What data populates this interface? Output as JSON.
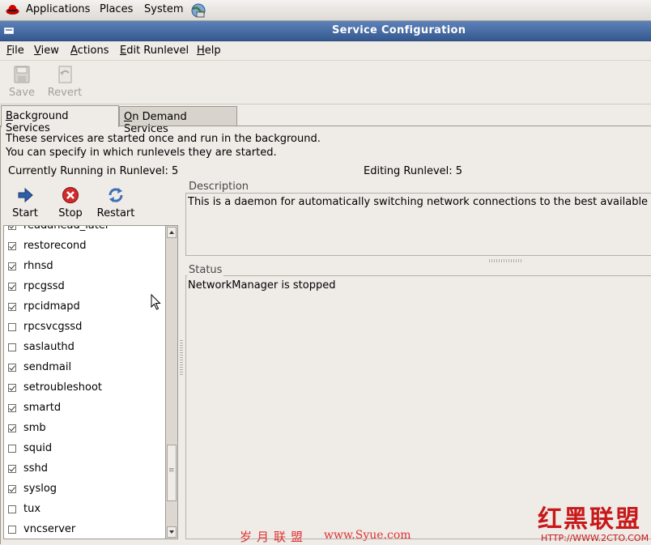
{
  "panel": {
    "applications": "Applications",
    "places": "Places",
    "system": "System"
  },
  "window": {
    "title": "Service Configuration"
  },
  "menubar": {
    "file": "File",
    "view": "View",
    "actions": "Actions",
    "edit_runlevel": "Edit Runlevel",
    "help": "Help"
  },
  "toolbar": {
    "save": "Save",
    "revert": "Revert"
  },
  "tabs": {
    "background": "Background Services",
    "on_demand": "On Demand Services"
  },
  "info": {
    "line1": "These services are started once and run in the background.",
    "line2": "You can specify in which runlevels they are started.",
    "current_runlevel": "Currently Running in Runlevel: 5",
    "editing_runlevel": "Editing Runlevel: 5"
  },
  "actions": {
    "start": "Start",
    "stop": "Stop",
    "restart": "Restart"
  },
  "services": [
    {
      "name": "readahead_later",
      "enabled": true
    },
    {
      "name": "restorecond",
      "enabled": true
    },
    {
      "name": "rhnsd",
      "enabled": true
    },
    {
      "name": "rpcgssd",
      "enabled": true
    },
    {
      "name": "rpcidmapd",
      "enabled": true
    },
    {
      "name": "rpcsvcgssd",
      "enabled": false
    },
    {
      "name": "saslauthd",
      "enabled": false
    },
    {
      "name": "sendmail",
      "enabled": true
    },
    {
      "name": "setroubleshoot",
      "enabled": true
    },
    {
      "name": "smartd",
      "enabled": true
    },
    {
      "name": "smb",
      "enabled": true
    },
    {
      "name": "squid",
      "enabled": false
    },
    {
      "name": "sshd",
      "enabled": true
    },
    {
      "name": "syslog",
      "enabled": true
    },
    {
      "name": "tux",
      "enabled": false
    },
    {
      "name": "vncserver",
      "enabled": false
    }
  ],
  "description": {
    "label": "Description",
    "text": "This is a daemon for automatically switching network connections to the best available co"
  },
  "status": {
    "label": "Status",
    "text": "NetworkManager is stopped"
  },
  "watermarks": {
    "cn_left": "岁月联盟",
    "url_left": "www.Syue.com",
    "cn_right": "红黑联盟",
    "url_right": "HTTP://WWW.2CTO.COM"
  },
  "colors": {
    "titlebar": "#3e639b",
    "window_bg": "#efebe7",
    "stop_red": "#d22b2b",
    "start_blue": "#2f5ea8",
    "watermark_red": "#c8191a"
  }
}
